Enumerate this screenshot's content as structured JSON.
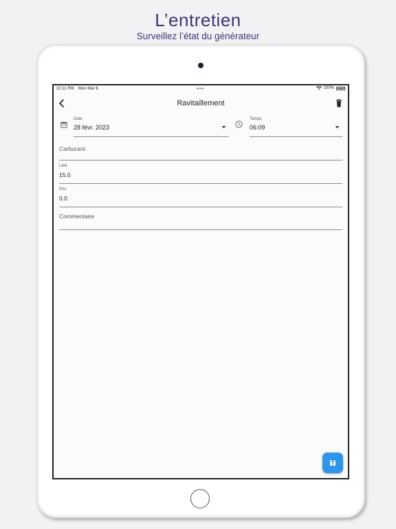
{
  "promo": {
    "title": "L’entretien",
    "subtitle": "Surveillez l’état du générateur"
  },
  "status_bar": {
    "time": "10:11 PM",
    "date": "Mon Mar 6",
    "battery": "100%",
    "icons": [
      "wifi-icon",
      "battery-icon"
    ]
  },
  "app_bar": {
    "title": "Ravitaillement",
    "back_icon": "chevron-left-icon",
    "delete_icon": "trash-icon"
  },
  "form": {
    "date": {
      "label": "Date",
      "value": "28 févr. 2023",
      "icon": "calendar-icon"
    },
    "time": {
      "label": "Temps",
      "value": "06:09",
      "icon": "clock-icon"
    },
    "carburant": {
      "placeholder": "Carburant",
      "value": ""
    },
    "litre": {
      "label": "Litre",
      "value": "15.0"
    },
    "prix": {
      "label": "Prix",
      "value": "0.0"
    },
    "commentaire": {
      "placeholder": "Commentaire",
      "value": ""
    }
  },
  "fab": {
    "icon": "save-icon"
  },
  "colors": {
    "accent": "#2f95ea",
    "promo_text": "#3d3575"
  }
}
